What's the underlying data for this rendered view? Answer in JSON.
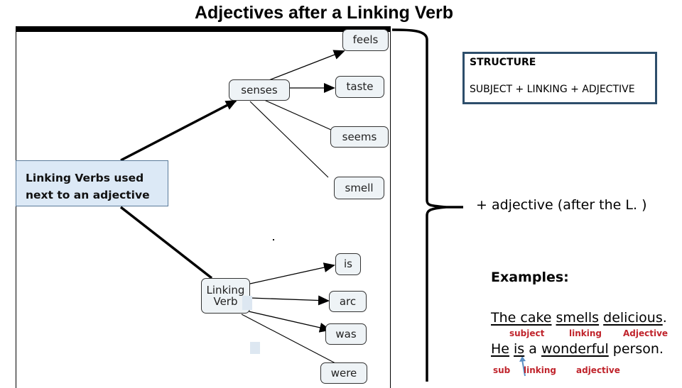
{
  "title": "Adjectives after a Linking Verb",
  "callout": {
    "line1": "Linking Verbs used",
    "line2": "next to an adjective"
  },
  "diagram": {
    "hubs": {
      "senses": "senses",
      "linking_verb_line1": "Linking",
      "linking_verb_line2": "Verb"
    },
    "senses_children": [
      "feels",
      "taste",
      "seems",
      "smell"
    ],
    "linking_children": [
      "is",
      "arc",
      "was",
      "were"
    ]
  },
  "structure": {
    "heading": "STRUCTURE",
    "formula": "SUBJECT + LINKING + ADJECTIVE"
  },
  "plus_adjective": "+  adjective (after the L. )",
  "examples": {
    "label": "Examples:",
    "sentence1": {
      "subject": "The cake",
      "linking": "smells",
      "adjective": "delicious",
      "end": ".",
      "tags": {
        "subject": "subject",
        "linking": "linking",
        "adjective": "Adjective"
      }
    },
    "sentence2": {
      "subject": "He",
      "linking": "is",
      "middle": "a",
      "adjective": "wonderful",
      "end": "person.",
      "tags": {
        "subject": "sub",
        "linking": "linking",
        "adjective": "adjective"
      }
    }
  },
  "colors": {
    "node_fill": "#eef3f6",
    "callout_fill": "#dce9f6",
    "structure_border": "#2d4e6b",
    "tag_red": "#c0242c",
    "arrow_blue": "#5b8fc4"
  }
}
